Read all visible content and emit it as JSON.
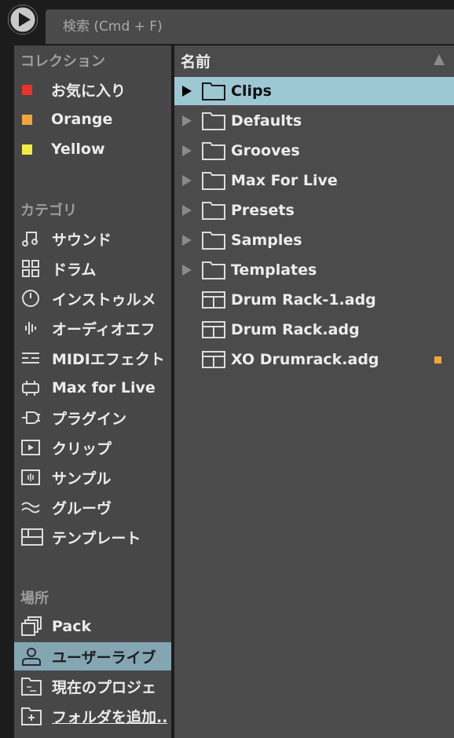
{
  "search": {
    "placeholder": "検索 (Cmd + F)"
  },
  "sidebar": {
    "collections_title": "コレクション",
    "collections": [
      {
        "label": "お気に入り",
        "color": "#e8322b"
      },
      {
        "label": "Orange",
        "color": "#f0a640"
      },
      {
        "label": "Yellow",
        "color": "#f2ea45"
      }
    ],
    "categories_title": "カテゴリ",
    "categories": [
      {
        "label": "サウンド",
        "icon": "music-note-icon"
      },
      {
        "label": "ドラム",
        "icon": "drum-grid-icon"
      },
      {
        "label": "インストゥルメ",
        "icon": "clock-icon"
      },
      {
        "label": "オーディオエフ",
        "icon": "waveform-icon"
      },
      {
        "label": "MIDIエフェクト",
        "icon": "midi-effect-icon"
      },
      {
        "label": "Max for Live",
        "icon": "max-device-icon"
      },
      {
        "label": "プラグイン",
        "icon": "plug-icon"
      },
      {
        "label": "クリップ",
        "icon": "clip-play-icon"
      },
      {
        "label": "サンプル",
        "icon": "sample-icon"
      },
      {
        "label": "グルーヴ",
        "icon": "groove-wave-icon"
      },
      {
        "label": "テンプレート",
        "icon": "template-icon"
      }
    ],
    "places_title": "場所",
    "places": [
      {
        "label": "Pack",
        "icon": "pack-icon"
      },
      {
        "label": "ユーザーライブ",
        "icon": "user-icon"
      },
      {
        "label": "現在のプロジェ",
        "icon": "project-folder-icon"
      },
      {
        "label": "フォルダを追加..",
        "icon": "add-folder-icon"
      }
    ]
  },
  "browser": {
    "column_header": "名前",
    "rows": [
      {
        "name": "Clips",
        "type": "folder",
        "selected": true
      },
      {
        "name": "Defaults",
        "type": "folder"
      },
      {
        "name": "Grooves",
        "type": "folder"
      },
      {
        "name": "Max For Live",
        "type": "folder"
      },
      {
        "name": "Presets",
        "type": "folder"
      },
      {
        "name": "Samples",
        "type": "folder"
      },
      {
        "name": "Templates",
        "type": "folder"
      },
      {
        "name": "Drum Rack-1.adg",
        "type": "rack"
      },
      {
        "name": "Drum Rack.adg",
        "type": "rack"
      },
      {
        "name": "XO Drumrack.adg",
        "type": "rack",
        "tag_color": "#f0a640"
      }
    ]
  }
}
